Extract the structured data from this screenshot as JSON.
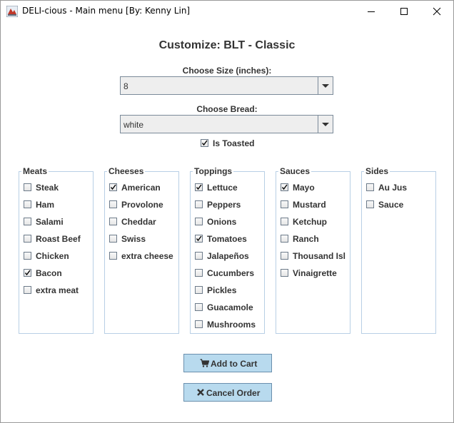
{
  "window": {
    "title": "DELI-cious - Main menu [By: Kenny Lin]",
    "controls": {
      "minimize": "minimize-icon",
      "maximize": "maximize-icon",
      "close": "close-icon"
    }
  },
  "heading": "Customize: BLT - Classic",
  "size": {
    "label": "Choose Size (inches):",
    "value": "8"
  },
  "bread": {
    "label": "Choose Bread:",
    "value": "white"
  },
  "toasted": {
    "label": "Is Toasted",
    "checked": true
  },
  "panels": [
    {
      "title": "Meats",
      "items": [
        {
          "label": "Steak",
          "checked": false
        },
        {
          "label": "Ham",
          "checked": false
        },
        {
          "label": "Salami",
          "checked": false
        },
        {
          "label": "Roast Beef",
          "checked": false
        },
        {
          "label": "Chicken",
          "checked": false
        },
        {
          "label": "Bacon",
          "checked": true
        },
        {
          "label": "extra meat",
          "checked": false
        }
      ]
    },
    {
      "title": "Cheeses",
      "items": [
        {
          "label": "American",
          "checked": true
        },
        {
          "label": "Provolone",
          "checked": false
        },
        {
          "label": "Cheddar",
          "checked": false
        },
        {
          "label": "Swiss",
          "checked": false
        },
        {
          "label": "extra cheese",
          "checked": false
        }
      ]
    },
    {
      "title": "Toppings",
      "items": [
        {
          "label": "Lettuce",
          "checked": true
        },
        {
          "label": "Peppers",
          "checked": false
        },
        {
          "label": "Onions",
          "checked": false
        },
        {
          "label": "Tomatoes",
          "checked": true
        },
        {
          "label": "Jalapeños",
          "checked": false
        },
        {
          "label": "Cucumbers",
          "checked": false
        },
        {
          "label": "Pickles",
          "checked": false
        },
        {
          "label": "Guacamole",
          "checked": false
        },
        {
          "label": "Mushrooms",
          "checked": false
        }
      ]
    },
    {
      "title": "Sauces",
      "items": [
        {
          "label": "Mayo",
          "checked": true
        },
        {
          "label": "Mustard",
          "checked": false
        },
        {
          "label": "Ketchup",
          "checked": false
        },
        {
          "label": "Ranch",
          "checked": false
        },
        {
          "label": "Thousand Isl",
          "checked": false
        },
        {
          "label": "Vinaigrette",
          "checked": false
        }
      ]
    },
    {
      "title": "Sides",
      "items": [
        {
          "label": "Au Jus",
          "checked": false
        },
        {
          "label": "Sauce",
          "checked": false
        }
      ]
    }
  ],
  "buttons": {
    "add_to_cart": {
      "label": "Add to Cart",
      "icon": "cart-icon"
    },
    "cancel_order": {
      "label": "Cancel Order",
      "icon": "x-icon"
    }
  },
  "colors": {
    "button_bg": "#b8daee",
    "panel_border": "#b8cfe5",
    "text": "#333333"
  }
}
